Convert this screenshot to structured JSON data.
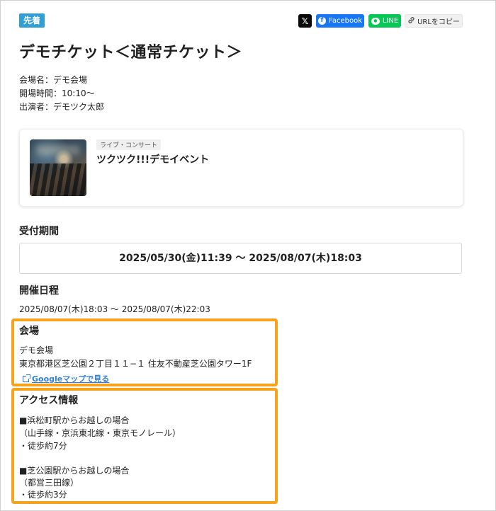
{
  "badge": "先着",
  "share": {
    "x_label": "𝕏",
    "facebook_label": "Facebook",
    "line_label": "LINE",
    "copy_label": "URLをコピー"
  },
  "title": "デモチケット＜通常チケット＞",
  "info": {
    "venue_line": "会場名：デモ会場",
    "time_line": "開場時間：10:10～",
    "performer_line": "出演者：デモツク太郎"
  },
  "event_card": {
    "genre": "ライブ・コンサート",
    "name": "ツクツク!!!デモイベント"
  },
  "reception": {
    "heading": "受付期間",
    "period": "2025/05/30(金)11:39 ～ 2025/08/07(木)18:03"
  },
  "schedule": {
    "heading": "開催日程",
    "dates": "2025/08/07(木)18:03 ～ 2025/08/07(木)22:03"
  },
  "venue": {
    "heading": "会場",
    "name": "デモ会場",
    "address": "東京都港区芝公園２丁目１１−１ 住友不動産芝公園タワー1F",
    "map_link": "Googleマップで見る"
  },
  "access": {
    "heading": "アクセス情報",
    "lines": [
      "■浜松町駅からお越しの場合",
      "（山手線・京浜東北線・東京モノレール）",
      "・徒歩約7分",
      "■芝公園駅からお越しの場合",
      "（都営三田線）",
      "・徒歩約3分"
    ]
  },
  "colors": {
    "badge": "#2f9fd6",
    "facebook": "#1877f2",
    "line": "#06c755",
    "highlight": "#f7a21b",
    "link": "#2f7fd9"
  },
  "icons": [
    "x-logo-icon",
    "facebook-icon",
    "line-icon",
    "link-icon",
    "external-link-icon"
  ]
}
